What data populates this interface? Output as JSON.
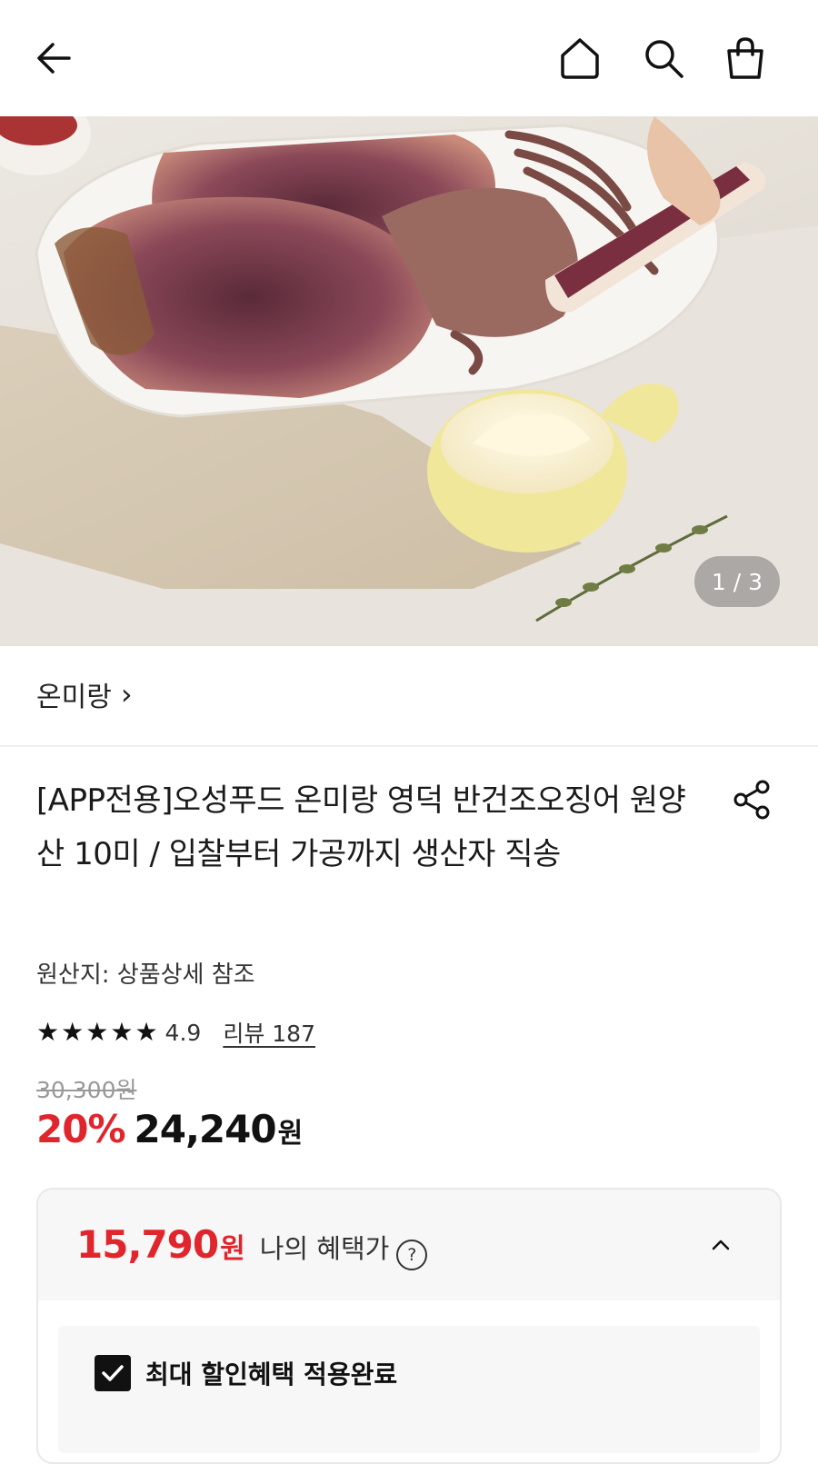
{
  "header": {
    "back_icon": "arrow-left-icon",
    "home_icon": "home-icon",
    "search_icon": "search-icon",
    "cart_icon": "shopping-bag-icon"
  },
  "gallery": {
    "counter": "1 / 3"
  },
  "product": {
    "brand": "온미랑",
    "brand_chevron": "›",
    "title": "[APP전용]오성푸드 온미랑 영덕 반건조오징어 원양산 10미 / 입찰부터 가공까지 생산자 직송",
    "origin": "원산지: 상품상세 참조",
    "rating": "4.9",
    "rating_stars": 5,
    "review_label": "리뷰 187",
    "original_price": "30,300원",
    "discount": "20%",
    "sale_price": "24,240",
    "sale_unit": "원"
  },
  "benefit": {
    "price": "15,790",
    "unit": "원",
    "label": "나의 혜택가",
    "help": "?",
    "applied_label": "최대 할인혜택 적용완료"
  },
  "colors": {
    "accent_red": "#e0262d",
    "text_dark": "#111111"
  }
}
